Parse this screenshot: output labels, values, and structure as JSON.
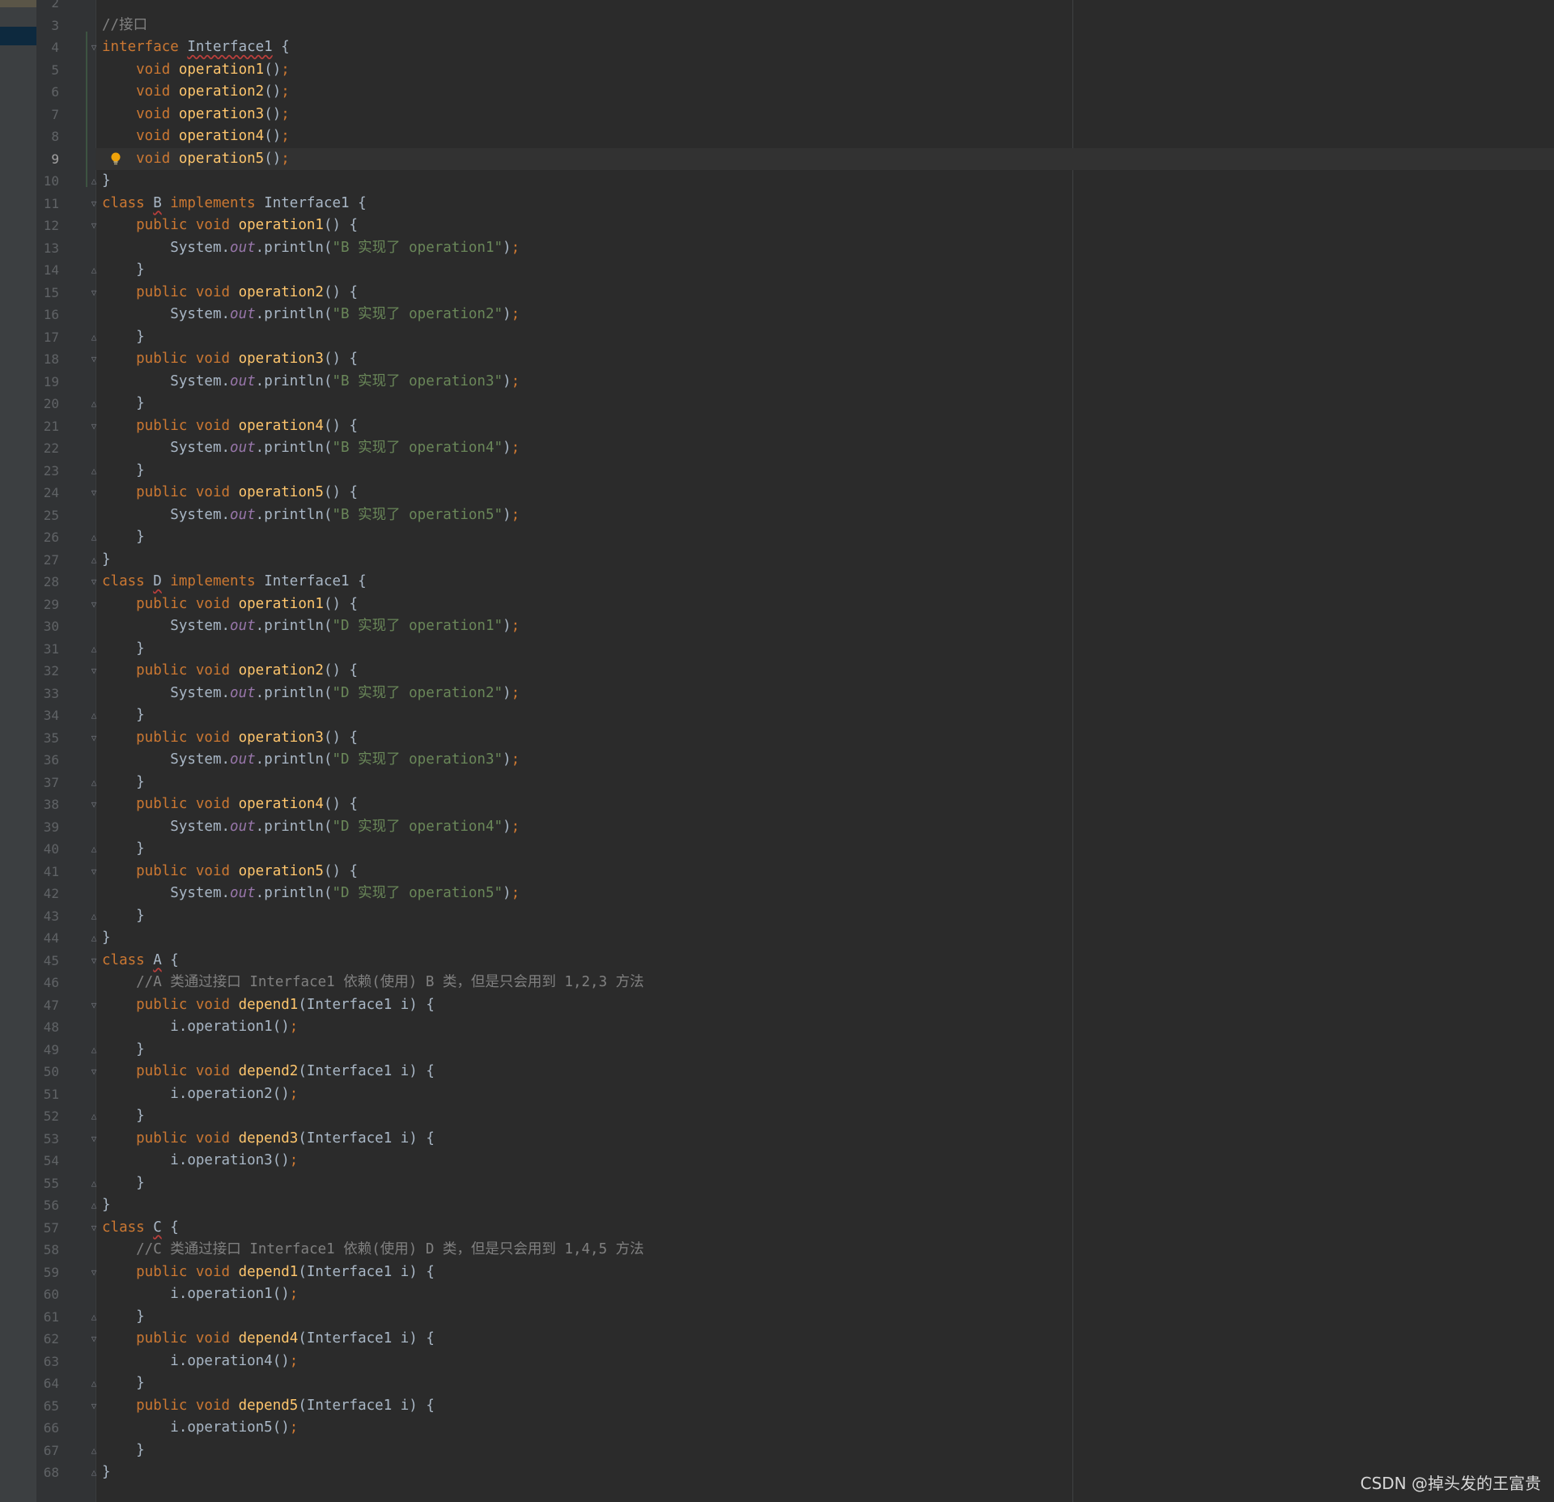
{
  "editor": {
    "current_line": 9,
    "lines": [
      {
        "n": "2",
        "tokens": []
      },
      {
        "n": "3",
        "tokens": [
          {
            "t": "//接口",
            "c": "cm"
          }
        ]
      },
      {
        "n": "4",
        "tokens": [
          {
            "t": "interface ",
            "c": "kw"
          },
          {
            "t": "Interface1",
            "c": "id sq"
          },
          {
            "t": " {",
            "c": "id"
          }
        ]
      },
      {
        "n": "5",
        "tokens": [
          {
            "t": "    void ",
            "c": "kw"
          },
          {
            "t": "operation1",
            "c": "fn"
          },
          {
            "t": "()",
            "c": "id"
          },
          {
            "t": ";",
            "c": "kw"
          }
        ]
      },
      {
        "n": "6",
        "tokens": [
          {
            "t": "    void ",
            "c": "kw"
          },
          {
            "t": "operation2",
            "c": "fn"
          },
          {
            "t": "()",
            "c": "id"
          },
          {
            "t": ";",
            "c": "kw"
          }
        ]
      },
      {
        "n": "7",
        "tokens": [
          {
            "t": "    void ",
            "c": "kw"
          },
          {
            "t": "operation3",
            "c": "fn"
          },
          {
            "t": "()",
            "c": "id"
          },
          {
            "t": ";",
            "c": "kw"
          }
        ]
      },
      {
        "n": "8",
        "tokens": [
          {
            "t": "    void ",
            "c": "kw"
          },
          {
            "t": "operation4",
            "c": "fn"
          },
          {
            "t": "()",
            "c": "id"
          },
          {
            "t": ";",
            "c": "kw"
          }
        ]
      },
      {
        "n": "9",
        "tokens": [
          {
            "t": "    void ",
            "c": "kw"
          },
          {
            "t": "operation5",
            "c": "fn"
          },
          {
            "t": "()",
            "c": "id"
          },
          {
            "t": ";",
            "c": "kw"
          }
        ]
      },
      {
        "n": "10",
        "tokens": [
          {
            "t": "}",
            "c": "id"
          }
        ]
      },
      {
        "n": "11",
        "tokens": [
          {
            "t": "class ",
            "c": "kw"
          },
          {
            "t": "B",
            "c": "id sq"
          },
          {
            "t": " implements ",
            "c": "kw"
          },
          {
            "t": "Interface1 {",
            "c": "id"
          }
        ]
      },
      {
        "n": "12",
        "tokens": [
          {
            "t": "    public void ",
            "c": "kw"
          },
          {
            "t": "operation1",
            "c": "fn"
          },
          {
            "t": "() {",
            "c": "id"
          }
        ]
      },
      {
        "n": "13",
        "tokens": [
          {
            "t": "        System.",
            "c": "id"
          },
          {
            "t": "out",
            "c": "st"
          },
          {
            "t": ".println(",
            "c": "id"
          },
          {
            "t": "\"B 实现了 operation1\"",
            "c": "str"
          },
          {
            "t": ")",
            "c": "id"
          },
          {
            "t": ";",
            "c": "kw"
          }
        ]
      },
      {
        "n": "14",
        "tokens": [
          {
            "t": "    }",
            "c": "id"
          }
        ]
      },
      {
        "n": "15",
        "tokens": [
          {
            "t": "    public void ",
            "c": "kw"
          },
          {
            "t": "operation2",
            "c": "fn"
          },
          {
            "t": "() {",
            "c": "id"
          }
        ]
      },
      {
        "n": "16",
        "tokens": [
          {
            "t": "        System.",
            "c": "id"
          },
          {
            "t": "out",
            "c": "st"
          },
          {
            "t": ".println(",
            "c": "id"
          },
          {
            "t": "\"B 实现了 operation2\"",
            "c": "str"
          },
          {
            "t": ")",
            "c": "id"
          },
          {
            "t": ";",
            "c": "kw"
          }
        ]
      },
      {
        "n": "17",
        "tokens": [
          {
            "t": "    }",
            "c": "id"
          }
        ]
      },
      {
        "n": "18",
        "tokens": [
          {
            "t": "    public void ",
            "c": "kw"
          },
          {
            "t": "operation3",
            "c": "fn"
          },
          {
            "t": "() {",
            "c": "id"
          }
        ]
      },
      {
        "n": "19",
        "tokens": [
          {
            "t": "        System.",
            "c": "id"
          },
          {
            "t": "out",
            "c": "st"
          },
          {
            "t": ".println(",
            "c": "id"
          },
          {
            "t": "\"B 实现了 operation3\"",
            "c": "str"
          },
          {
            "t": ")",
            "c": "id"
          },
          {
            "t": ";",
            "c": "kw"
          }
        ]
      },
      {
        "n": "20",
        "tokens": [
          {
            "t": "    }",
            "c": "id"
          }
        ]
      },
      {
        "n": "21",
        "tokens": [
          {
            "t": "    public void ",
            "c": "kw"
          },
          {
            "t": "operation4",
            "c": "fn"
          },
          {
            "t": "() {",
            "c": "id"
          }
        ]
      },
      {
        "n": "22",
        "tokens": [
          {
            "t": "        System.",
            "c": "id"
          },
          {
            "t": "out",
            "c": "st"
          },
          {
            "t": ".println(",
            "c": "id"
          },
          {
            "t": "\"B 实现了 operation4\"",
            "c": "str"
          },
          {
            "t": ")",
            "c": "id"
          },
          {
            "t": ";",
            "c": "kw"
          }
        ]
      },
      {
        "n": "23",
        "tokens": [
          {
            "t": "    }",
            "c": "id"
          }
        ]
      },
      {
        "n": "24",
        "tokens": [
          {
            "t": "    public void ",
            "c": "kw"
          },
          {
            "t": "operation5",
            "c": "fn"
          },
          {
            "t": "() {",
            "c": "id"
          }
        ]
      },
      {
        "n": "25",
        "tokens": [
          {
            "t": "        System.",
            "c": "id"
          },
          {
            "t": "out",
            "c": "st"
          },
          {
            "t": ".println(",
            "c": "id"
          },
          {
            "t": "\"B 实现了 operation5\"",
            "c": "str"
          },
          {
            "t": ")",
            "c": "id"
          },
          {
            "t": ";",
            "c": "kw"
          }
        ]
      },
      {
        "n": "26",
        "tokens": [
          {
            "t": "    }",
            "c": "id"
          }
        ]
      },
      {
        "n": "27",
        "tokens": [
          {
            "t": "}",
            "c": "id"
          }
        ]
      },
      {
        "n": "28",
        "tokens": [
          {
            "t": "class ",
            "c": "kw"
          },
          {
            "t": "D",
            "c": "id sq"
          },
          {
            "t": " implements ",
            "c": "kw"
          },
          {
            "t": "Interface1 {",
            "c": "id"
          }
        ]
      },
      {
        "n": "29",
        "tokens": [
          {
            "t": "    public void ",
            "c": "kw"
          },
          {
            "t": "operation1",
            "c": "fn"
          },
          {
            "t": "() {",
            "c": "id"
          }
        ]
      },
      {
        "n": "30",
        "tokens": [
          {
            "t": "        System.",
            "c": "id"
          },
          {
            "t": "out",
            "c": "st"
          },
          {
            "t": ".println(",
            "c": "id"
          },
          {
            "t": "\"D 实现了 operation1\"",
            "c": "str"
          },
          {
            "t": ")",
            "c": "id"
          },
          {
            "t": ";",
            "c": "kw"
          }
        ]
      },
      {
        "n": "31",
        "tokens": [
          {
            "t": "    }",
            "c": "id"
          }
        ]
      },
      {
        "n": "32",
        "tokens": [
          {
            "t": "    public void ",
            "c": "kw"
          },
          {
            "t": "operation2",
            "c": "fn"
          },
          {
            "t": "() {",
            "c": "id"
          }
        ]
      },
      {
        "n": "33",
        "tokens": [
          {
            "t": "        System.",
            "c": "id"
          },
          {
            "t": "out",
            "c": "st"
          },
          {
            "t": ".println(",
            "c": "id"
          },
          {
            "t": "\"D 实现了 operation2\"",
            "c": "str"
          },
          {
            "t": ")",
            "c": "id"
          },
          {
            "t": ";",
            "c": "kw"
          }
        ]
      },
      {
        "n": "34",
        "tokens": [
          {
            "t": "    }",
            "c": "id"
          }
        ]
      },
      {
        "n": "35",
        "tokens": [
          {
            "t": "    public void ",
            "c": "kw"
          },
          {
            "t": "operation3",
            "c": "fn"
          },
          {
            "t": "() {",
            "c": "id"
          }
        ]
      },
      {
        "n": "36",
        "tokens": [
          {
            "t": "        System.",
            "c": "id"
          },
          {
            "t": "out",
            "c": "st"
          },
          {
            "t": ".println(",
            "c": "id"
          },
          {
            "t": "\"D 实现了 operation3\"",
            "c": "str"
          },
          {
            "t": ")",
            "c": "id"
          },
          {
            "t": ";",
            "c": "kw"
          }
        ]
      },
      {
        "n": "37",
        "tokens": [
          {
            "t": "    }",
            "c": "id"
          }
        ]
      },
      {
        "n": "38",
        "tokens": [
          {
            "t": "    public void ",
            "c": "kw"
          },
          {
            "t": "operation4",
            "c": "fn"
          },
          {
            "t": "() {",
            "c": "id"
          }
        ]
      },
      {
        "n": "39",
        "tokens": [
          {
            "t": "        System.",
            "c": "id"
          },
          {
            "t": "out",
            "c": "st"
          },
          {
            "t": ".println(",
            "c": "id"
          },
          {
            "t": "\"D 实现了 operation4\"",
            "c": "str"
          },
          {
            "t": ")",
            "c": "id"
          },
          {
            "t": ";",
            "c": "kw"
          }
        ]
      },
      {
        "n": "40",
        "tokens": [
          {
            "t": "    }",
            "c": "id"
          }
        ]
      },
      {
        "n": "41",
        "tokens": [
          {
            "t": "    public void ",
            "c": "kw"
          },
          {
            "t": "operation5",
            "c": "fn"
          },
          {
            "t": "() {",
            "c": "id"
          }
        ]
      },
      {
        "n": "42",
        "tokens": [
          {
            "t": "        System.",
            "c": "id"
          },
          {
            "t": "out",
            "c": "st"
          },
          {
            "t": ".println(",
            "c": "id"
          },
          {
            "t": "\"D 实现了 operation5\"",
            "c": "str"
          },
          {
            "t": ")",
            "c": "id"
          },
          {
            "t": ";",
            "c": "kw"
          }
        ]
      },
      {
        "n": "43",
        "tokens": [
          {
            "t": "    }",
            "c": "id"
          }
        ]
      },
      {
        "n": "44",
        "tokens": [
          {
            "t": "}",
            "c": "id"
          }
        ]
      },
      {
        "n": "45",
        "tokens": [
          {
            "t": "class ",
            "c": "kw"
          },
          {
            "t": "A",
            "c": "id sq"
          },
          {
            "t": " {",
            "c": "id"
          }
        ]
      },
      {
        "n": "46",
        "tokens": [
          {
            "t": "    //A 类通过接口 Interface1 依赖(使用) B 类，但是只会用到 1,2,3 方法",
            "c": "cm"
          }
        ]
      },
      {
        "n": "47",
        "tokens": [
          {
            "t": "    public void ",
            "c": "kw"
          },
          {
            "t": "depend1",
            "c": "fn"
          },
          {
            "t": "(Interface1 i) {",
            "c": "id"
          }
        ]
      },
      {
        "n": "48",
        "tokens": [
          {
            "t": "        i.operation1()",
            "c": "id"
          },
          {
            "t": ";",
            "c": "kw"
          }
        ]
      },
      {
        "n": "49",
        "tokens": [
          {
            "t": "    }",
            "c": "id"
          }
        ]
      },
      {
        "n": "50",
        "tokens": [
          {
            "t": "    public void ",
            "c": "kw"
          },
          {
            "t": "depend2",
            "c": "fn"
          },
          {
            "t": "(Interface1 i) {",
            "c": "id"
          }
        ]
      },
      {
        "n": "51",
        "tokens": [
          {
            "t": "        i.operation2()",
            "c": "id"
          },
          {
            "t": ";",
            "c": "kw"
          }
        ]
      },
      {
        "n": "52",
        "tokens": [
          {
            "t": "    }",
            "c": "id"
          }
        ]
      },
      {
        "n": "53",
        "tokens": [
          {
            "t": "    public void ",
            "c": "kw"
          },
          {
            "t": "depend3",
            "c": "fn"
          },
          {
            "t": "(Interface1 i) {",
            "c": "id"
          }
        ]
      },
      {
        "n": "54",
        "tokens": [
          {
            "t": "        i.operation3()",
            "c": "id"
          },
          {
            "t": ";",
            "c": "kw"
          }
        ]
      },
      {
        "n": "55",
        "tokens": [
          {
            "t": "    }",
            "c": "id"
          }
        ]
      },
      {
        "n": "56",
        "tokens": [
          {
            "t": "}",
            "c": "id"
          }
        ]
      },
      {
        "n": "57",
        "tokens": [
          {
            "t": "class ",
            "c": "kw"
          },
          {
            "t": "C",
            "c": "id sq"
          },
          {
            "t": " {",
            "c": "id"
          }
        ]
      },
      {
        "n": "58",
        "tokens": [
          {
            "t": "    //C 类通过接口 Interface1 依赖(使用) D 类，但是只会用到 1,4,5 方法",
            "c": "cm"
          }
        ]
      },
      {
        "n": "59",
        "tokens": [
          {
            "t": "    public void ",
            "c": "kw"
          },
          {
            "t": "depend1",
            "c": "fn"
          },
          {
            "t": "(Interface1 i) {",
            "c": "id"
          }
        ]
      },
      {
        "n": "60",
        "tokens": [
          {
            "t": "        i.operation1()",
            "c": "id"
          },
          {
            "t": ";",
            "c": "kw"
          }
        ]
      },
      {
        "n": "61",
        "tokens": [
          {
            "t": "    }",
            "c": "id"
          }
        ]
      },
      {
        "n": "62",
        "tokens": [
          {
            "t": "    public void ",
            "c": "kw"
          },
          {
            "t": "depend4",
            "c": "fn"
          },
          {
            "t": "(Interface1 i) {",
            "c": "id"
          }
        ]
      },
      {
        "n": "63",
        "tokens": [
          {
            "t": "        i.operation4()",
            "c": "id"
          },
          {
            "t": ";",
            "c": "kw"
          }
        ]
      },
      {
        "n": "64",
        "tokens": [
          {
            "t": "    }",
            "c": "id"
          }
        ]
      },
      {
        "n": "65",
        "tokens": [
          {
            "t": "    public void ",
            "c": "kw"
          },
          {
            "t": "depend5",
            "c": "fn"
          },
          {
            "t": "(Interface1 i) {",
            "c": "id"
          }
        ]
      },
      {
        "n": "66",
        "tokens": [
          {
            "t": "        i.operation5()",
            "c": "id"
          },
          {
            "t": ";",
            "c": "kw"
          }
        ]
      },
      {
        "n": "67",
        "tokens": [
          {
            "t": "    }",
            "c": "id"
          }
        ]
      },
      {
        "n": "68",
        "tokens": [
          {
            "t": "}",
            "c": "id"
          }
        ]
      }
    ],
    "fold_open_lines": [
      "4",
      "11",
      "12",
      "15",
      "18",
      "21",
      "24",
      "28",
      "29",
      "32",
      "35",
      "38",
      "41",
      "45",
      "47",
      "50",
      "53",
      "57",
      "59",
      "62",
      "65"
    ],
    "fold_close_lines": [
      "10",
      "14",
      "17",
      "20",
      "23",
      "26",
      "27",
      "31",
      "34",
      "37",
      "40",
      "43",
      "44",
      "49",
      "52",
      "55",
      "56",
      "61",
      "64",
      "67",
      "68"
    ],
    "intention_bulb_line": "9",
    "colors": {
      "background": "#2b2b2b",
      "gutter": "#313335",
      "keyword": "#cc7832",
      "method": "#ffc66d",
      "string": "#6a8759",
      "comment": "#808080",
      "static_field": "#9876aa",
      "text": "#a9b7c6",
      "bulb": "#f0a30a"
    }
  },
  "watermark": {
    "text": "CSDN @掉头发的王富贵"
  }
}
